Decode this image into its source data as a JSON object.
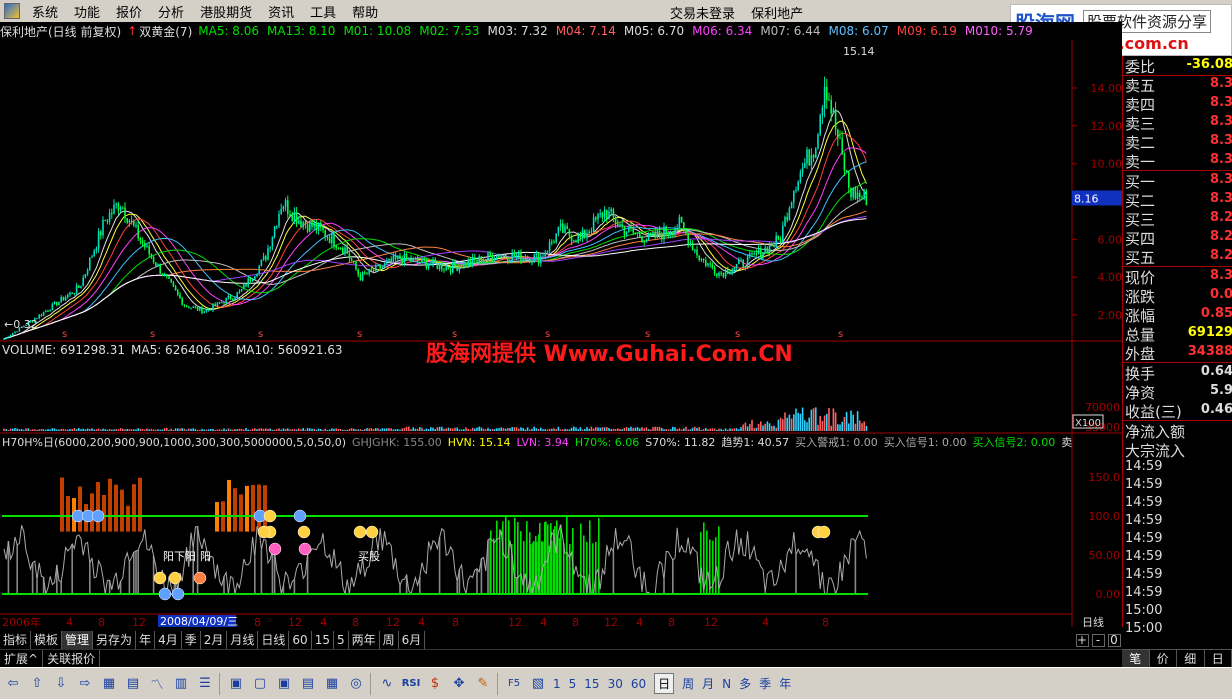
{
  "menu": {
    "items": [
      "系统",
      "功能",
      "报价",
      "分析",
      "港股期货",
      "资讯",
      "工具",
      "帮助"
    ],
    "status": "交易未登录",
    "stock": "保利地产"
  },
  "brand": {
    "name": "股海网",
    "tagline": "股票软件资源分享",
    "url": "www.Guhai.com.cn"
  },
  "watermark": "股海网提供 Www.Guhai.Com.CN",
  "title_bar": {
    "stock_label": "保利地产(日线 前复权)",
    "indicator": "双黄金(7)",
    "mas": [
      {
        "label": "MA5: 8.06",
        "color": "#00e000"
      },
      {
        "label": "MA13: 8.10",
        "color": "#00e000"
      },
      {
        "label": "M01: 10.08",
        "color": "#00e000"
      },
      {
        "label": "M02: 7.53",
        "color": "#00e000"
      },
      {
        "label": "M03: 7.32",
        "color": "#dddddd"
      },
      {
        "label": "M04: 7.14",
        "color": "#ff6060"
      },
      {
        "label": "M05: 6.70",
        "color": "#dddddd"
      },
      {
        "label": "M06: 6.34",
        "color": "#ff40ff"
      },
      {
        "label": "M07: 6.44",
        "color": "#bbbbbb"
      },
      {
        "label": "M08: 6.07",
        "color": "#60c0ff"
      },
      {
        "label": "M09: 6.19",
        "color": "#ff4040"
      },
      {
        "label": "M010: 5.79",
        "color": "#ff60ff"
      }
    ]
  },
  "price_axis": {
    "ticks": [
      "14.00",
      "12.00",
      "10.00",
      "8.00",
      "6.00",
      "4.00",
      "2.00"
    ],
    "current": "8.16",
    "high_label": "15.14",
    "low_label": "0.32"
  },
  "volume": {
    "title": "VOLUME: 691298.31",
    "ma5": "MA5: 626406.38",
    "ma10": "MA10: 560921.63",
    "ticks": [
      "70000",
      "35000"
    ],
    "unit": "X100"
  },
  "h70": {
    "title": "H70H%日(6000,200,900,900,1000,300,300,5000000,5,0,50,0)",
    "items": [
      {
        "label": "GHJGHK: 155.00",
        "color": "#888888"
      },
      {
        "label": "HVN: 15.14",
        "color": "#ffff00"
      },
      {
        "label": "LVN: 3.94",
        "color": "#ff40ff"
      },
      {
        "label": "H70%: 6.06",
        "color": "#00e000"
      },
      {
        "label": "S70%: 11.82",
        "color": "#dddddd"
      },
      {
        "label": "趋势1: 40.57",
        "color": "#dddddd"
      },
      {
        "label": "买入警戒1: 0.00",
        "color": "#aaaaaa"
      },
      {
        "label": "买入信号1: 0.00",
        "color": "#aaaaaa"
      },
      {
        "label": "买入信号2: 0.00",
        "color": "#00e000"
      },
      {
        "label": "卖",
        "color": "#dddddd"
      }
    ],
    "ticks": [
      "150.0",
      "100.0",
      "50.00",
      "0.00"
    ],
    "annotations": [
      "阳下阳",
      "阳",
      "买股"
    ]
  },
  "time_axis": {
    "start": "2006年",
    "cursor": "2008/04/09/三",
    "labels": [
      "4",
      "8",
      "12",
      "4",
      "8",
      "12",
      "4",
      "8",
      "12",
      "4",
      "8",
      "12",
      "4",
      "8",
      "12",
      "4",
      "8",
      "12",
      "4",
      "8"
    ],
    "period": "日线"
  },
  "quote": {
    "weibi_label": "委比",
    "weibi_value": "-36.08",
    "sells": [
      {
        "label": "卖五",
        "value": "8.3"
      },
      {
        "label": "卖四",
        "value": "8.3"
      },
      {
        "label": "卖三",
        "value": "8.3"
      },
      {
        "label": "卖二",
        "value": "8.3"
      },
      {
        "label": "卖一",
        "value": "8.3"
      }
    ],
    "buys": [
      {
        "label": "买一",
        "value": "8.3"
      },
      {
        "label": "买二",
        "value": "8.3"
      },
      {
        "label": "买三",
        "value": "8.2"
      },
      {
        "label": "买四",
        "value": "8.2"
      },
      {
        "label": "买五",
        "value": "8.2"
      }
    ],
    "stats": [
      {
        "label": "现价",
        "value": "8.3",
        "color": "#ff3030"
      },
      {
        "label": "涨跌",
        "value": "0.0",
        "color": "#ff3030"
      },
      {
        "label": "涨幅",
        "value": "0.85",
        "color": "#ff3030"
      },
      {
        "label": "总量",
        "value": "69129",
        "color": "#ffff00"
      },
      {
        "label": "外盘",
        "value": "34388",
        "color": "#ff3030"
      }
    ],
    "stats2": [
      {
        "label": "换手",
        "value": "0.64",
        "color": "#dddddd"
      },
      {
        "label": "净资",
        "value": "5.9",
        "color": "#dddddd"
      },
      {
        "label": "收益(三)",
        "value": "0.46",
        "color": "#dddddd"
      }
    ],
    "flow": [
      "净流入额",
      "大宗流入"
    ],
    "times": [
      "14:59",
      "14:59",
      "14:59",
      "14:59",
      "14:59",
      "14:59",
      "14:59",
      "14:59",
      "15:00",
      "15:00"
    ]
  },
  "tabs": [
    "指标",
    "模板",
    "管理",
    "另存为",
    "年",
    "4月",
    "季",
    "2月",
    "月线",
    "日线",
    "60",
    "15",
    "5",
    "两年",
    "周",
    "6月"
  ],
  "subtabs": [
    "扩展^",
    "关联报价"
  ],
  "quote_tabs": [
    "笔",
    "价",
    "细",
    "日"
  ],
  "zoom_buttons": [
    "+",
    "-",
    "0"
  ],
  "toolbar": {
    "periods": [
      "1",
      "5",
      "15",
      "30",
      "60",
      "日",
      "周",
      "月",
      "N",
      "多",
      "季",
      "年"
    ],
    "active_period": "日"
  }
}
